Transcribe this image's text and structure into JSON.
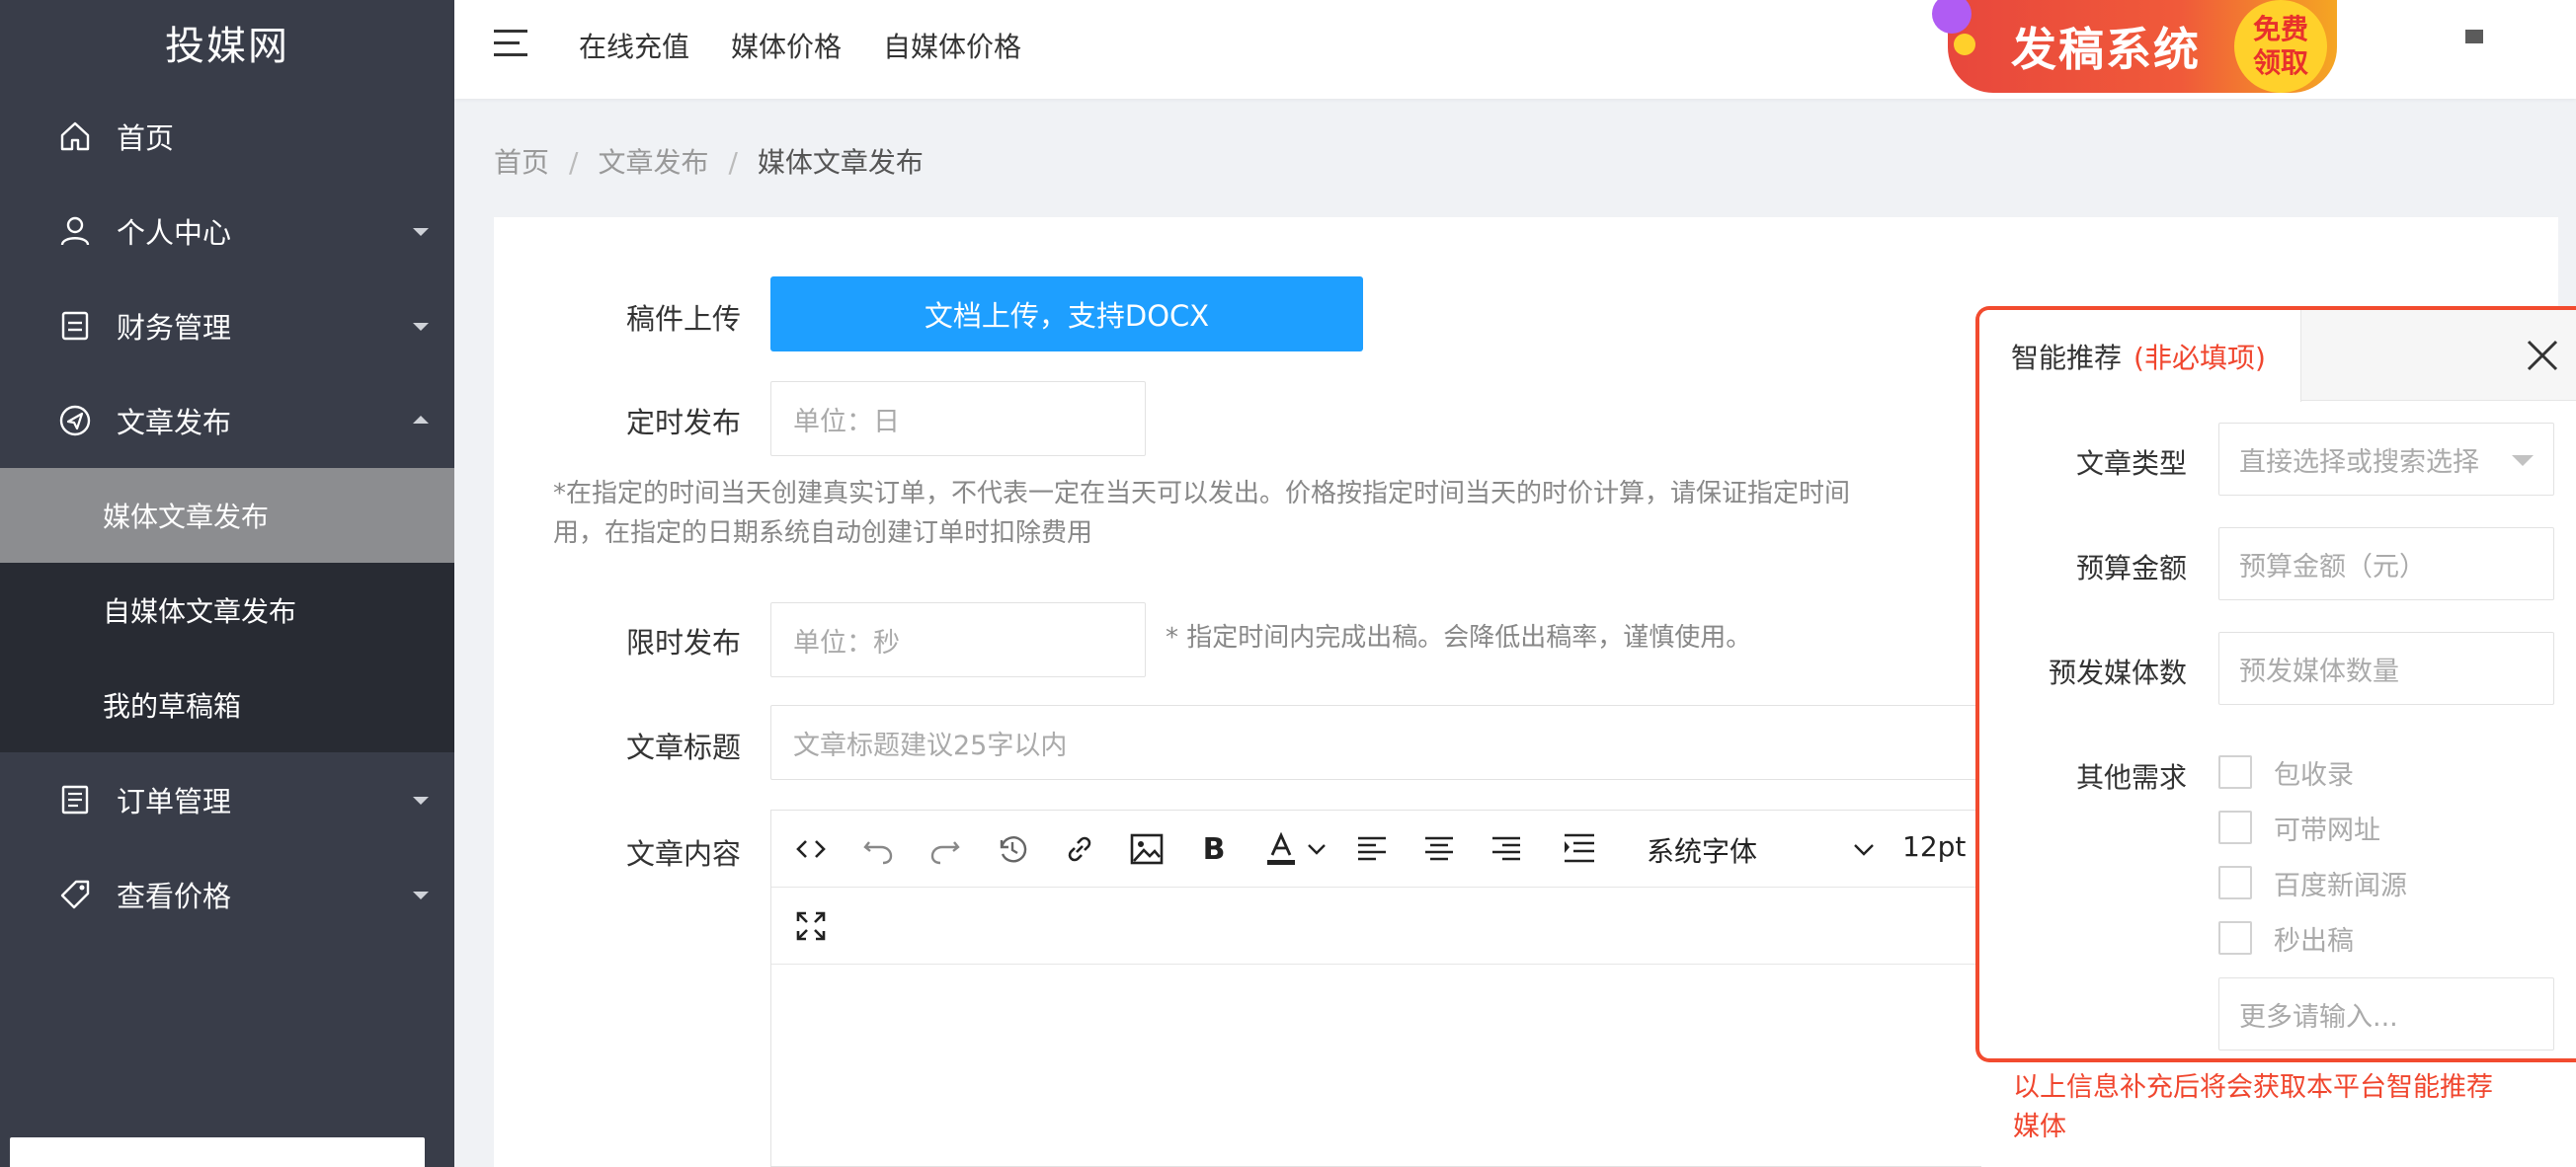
{
  "sidebar": {
    "logo": "投媒网",
    "items": [
      {
        "label": "首页"
      },
      {
        "label": "个人中心"
      },
      {
        "label": "财务管理"
      },
      {
        "label": "文章发布"
      },
      {
        "label": "订单管理"
      },
      {
        "label": "查看价格"
      }
    ],
    "sub_items": [
      {
        "label": "媒体文章发布",
        "active": true
      },
      {
        "label": "自媒体文章发布"
      },
      {
        "label": "我的草稿箱"
      }
    ]
  },
  "header": {
    "links": [
      "在线充值",
      "媒体价格",
      "自媒体价格"
    ],
    "banner": {
      "title": "发稿系统",
      "badge_line1": "免费",
      "badge_line2": "领取"
    }
  },
  "breadcrumb": {
    "items": [
      "首页",
      "文章发布",
      "媒体文章发布"
    ],
    "separator": "/"
  },
  "form": {
    "upload_label": "稿件上传",
    "upload_button": "文档上传，支持DOCX",
    "scheduled_label": "定时发布",
    "scheduled_placeholder": "单位：日",
    "scheduled_note_line1": "*在指定的时间当天创建真实订单，不代表一定在当天可以发出。价格按指定时间当天的时价计算，请保证指定时间",
    "scheduled_note_line2": "用，在指定的日期系统自动创建订单时扣除费用",
    "limit_label": "限时发布",
    "limit_placeholder": "单位：秒",
    "limit_note": "* 指定时间内完成出稿。会降低出稿率，谨慎使用。",
    "title_label": "文章标题",
    "title_placeholder": "文章标题建议25字以内",
    "content_label": "文章内容",
    "editor": {
      "font_family": "系统字体",
      "font_size": "12pt"
    }
  },
  "recommend": {
    "tab_label": "智能推荐",
    "tab_optional": "(非必填项)",
    "type_label": "文章类型",
    "type_placeholder": "直接选择或搜索选择",
    "budget_label": "预算金额",
    "budget_placeholder": "预算金额（元）",
    "count_label": "预发媒体数",
    "count_placeholder": "预发媒体数量",
    "other_label": "其他需求",
    "options": [
      "包收录",
      "可带网址",
      "百度新闻源",
      "秒出稿"
    ],
    "more_placeholder": "更多请输入...",
    "footer_line1": "以上信息补充后将会获取本平台智能推荐",
    "footer_line2": "媒体"
  },
  "colors": {
    "sidebar": "#393d49",
    "sidebar_sub": "#282b33",
    "primary": "#1e9fff",
    "highlight": "#f24b2f"
  }
}
